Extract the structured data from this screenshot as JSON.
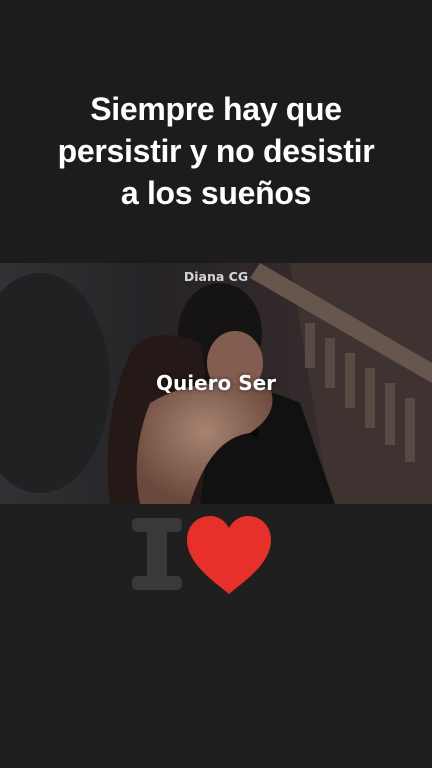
{
  "caption": {
    "text": "Siempre hay que\npersistir y no desistir\na los sueños"
  },
  "video": {
    "watermark": "Diana CG",
    "overlay_text": "Quiero Ser"
  },
  "sticker": {
    "letter": "I",
    "letter_color": "#3a393a",
    "heart_color": "#e8302b"
  },
  "colors": {
    "background": "#1c1c1c",
    "text": "#ffffff"
  }
}
